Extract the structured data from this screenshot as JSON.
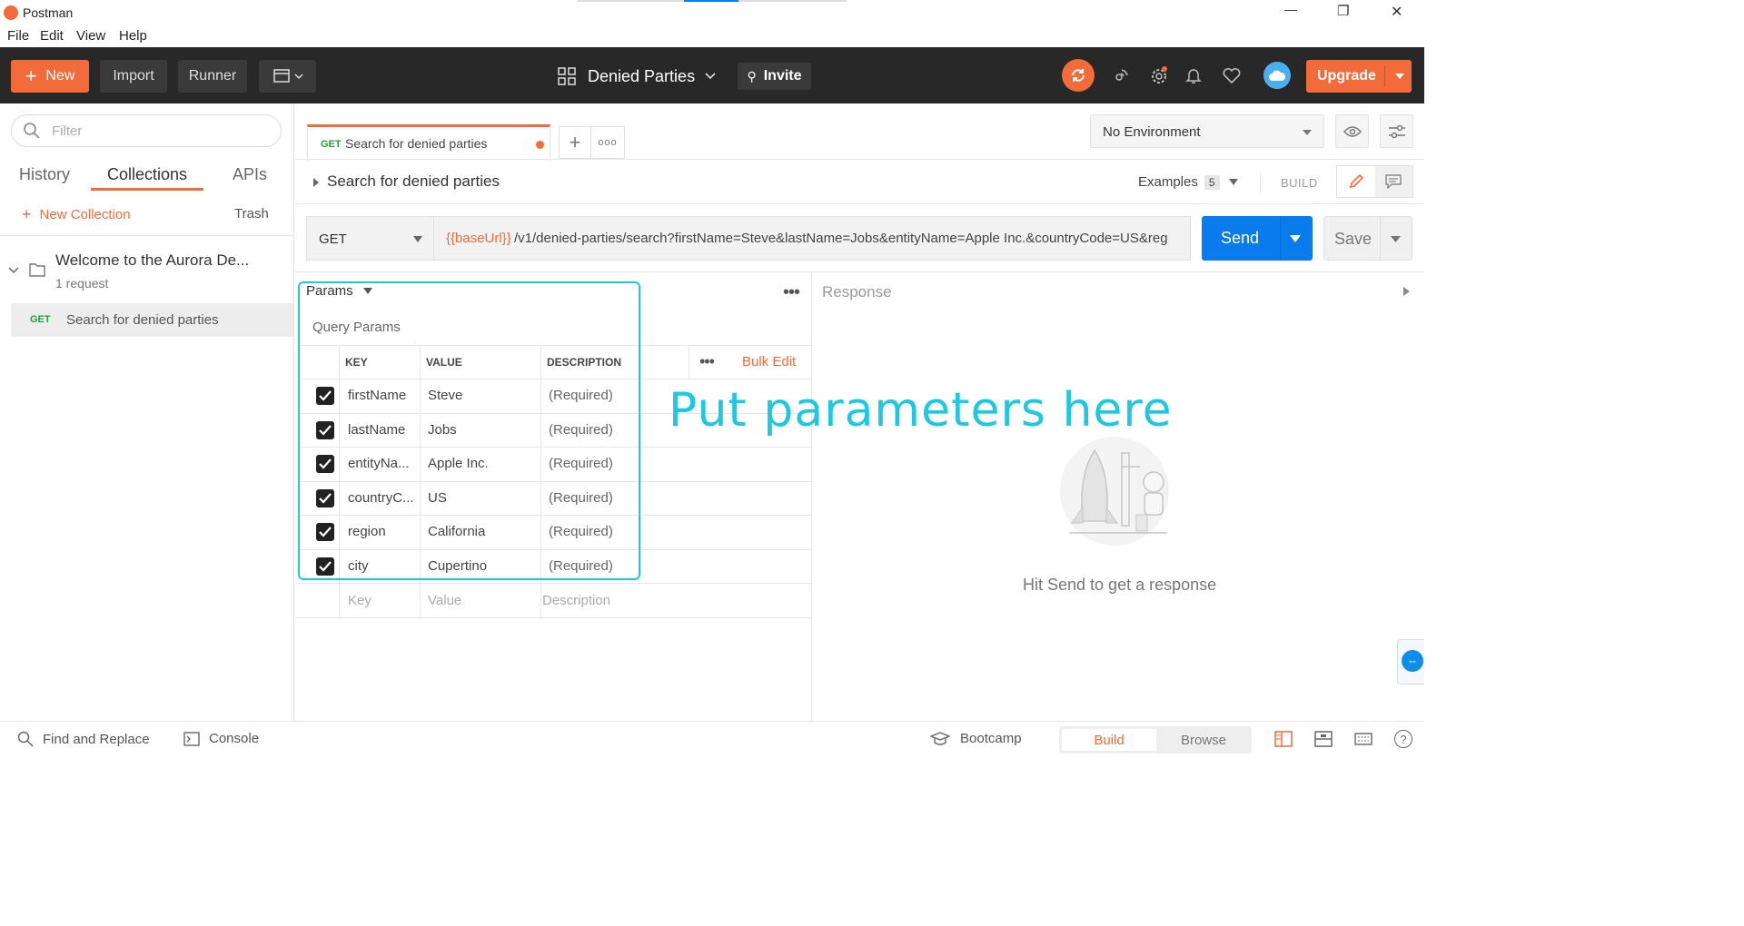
{
  "window": {
    "title": "Postman",
    "minimize": "—",
    "maximize": "❐",
    "close": "✕"
  },
  "menu": [
    "File",
    "Edit",
    "View",
    "Help"
  ],
  "header": {
    "new_label": "New",
    "import_label": "Import",
    "runner_label": "Runner",
    "workspace": "Denied Parties",
    "invite_label": "Invite",
    "upgrade_label": "Upgrade"
  },
  "sidebar": {
    "filter_placeholder": "Filter",
    "tabs": [
      "History",
      "Collections",
      "APIs"
    ],
    "active_tab": "Collections",
    "new_collection": "New Collection",
    "trash": "Trash",
    "collection": {
      "name": "Welcome to the Aurora De...",
      "count": "1 request"
    },
    "request": {
      "method": "GET",
      "name": "Search for denied parties"
    }
  },
  "tab": {
    "method": "GET",
    "name": "Search for denied parties"
  },
  "environment": {
    "selected": "No Environment"
  },
  "request_title": "Search for denied parties",
  "examples": {
    "label": "Examples",
    "count": "5"
  },
  "build_label": "BUILD",
  "url": {
    "method": "GET",
    "var": "{{baseUrl}}",
    "path": "/v1/denied-parties/search?firstName=Steve&lastName=Jobs&entityName=Apple Inc.&countryCode=US&reg"
  },
  "send_label": "Send",
  "save_label": "Save",
  "params": {
    "tab_label": "Params",
    "section_label": "Query Params",
    "headers": [
      "KEY",
      "VALUE",
      "DESCRIPTION"
    ],
    "bulk_edit": "Bulk Edit",
    "rows": [
      {
        "key": "firstName",
        "value": "Steve",
        "description": "(Required)"
      },
      {
        "key": "lastName",
        "value": "Jobs",
        "description": "(Required)"
      },
      {
        "key": "entityNa...",
        "value": "Apple Inc.",
        "description": "(Required)"
      },
      {
        "key": "countryC...",
        "value": "US",
        "description": "(Required)"
      },
      {
        "key": "region",
        "value": "California",
        "description": "(Required)"
      },
      {
        "key": "city",
        "value": "Cupertino",
        "description": "(Required)"
      }
    ],
    "placeholder": {
      "key": "Key",
      "value": "Value",
      "description": "Description"
    }
  },
  "annotation": "Put parameters here",
  "response": {
    "label": "Response",
    "empty": "Hit Send to get a response"
  },
  "footer": {
    "find_replace": "Find and Replace",
    "console": "Console",
    "bootcamp": "Bootcamp",
    "build": "Build",
    "browse": "Browse"
  },
  "colors": {
    "accent": "#f26b3a",
    "send": "#097bed",
    "annotation": "#1ec8e0",
    "get": "#2a9d3a"
  }
}
